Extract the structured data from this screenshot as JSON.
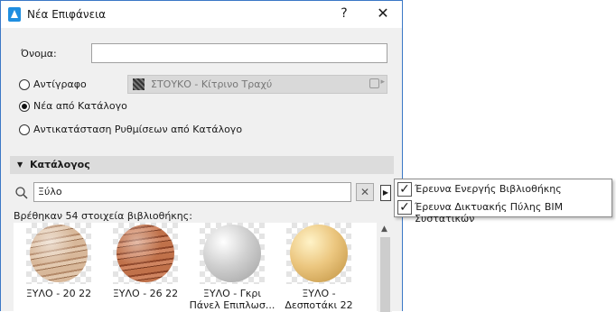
{
  "window": {
    "title": "Νέα Επιφάνεια",
    "help": "?",
    "close": "✕"
  },
  "form": {
    "name_label": "Όνομα:",
    "name_value": "",
    "options": [
      {
        "label": "Αντίγραφο",
        "selected": false
      },
      {
        "label": "Νέα από Κατάλογο",
        "selected": true
      },
      {
        "label": "Αντικατάσταση Ρυθμίσεων από Κατάλογο",
        "selected": false
      }
    ],
    "copy_source": "ΣΤΟΥΚΟ - Κίτρινο Τραχύ"
  },
  "catalog": {
    "section_label": "Κατάλογος",
    "search_value": "Ξύλο",
    "clear_label": "✕",
    "more_label": "▶",
    "found_text": "Βρέθηκαν 54 στοιχεία βιβλιοθήκης:",
    "items": [
      {
        "label": "ΞΥΛΟ - 20 22"
      },
      {
        "label": "ΞΥΛΟ - 26 22"
      },
      {
        "label": "ΞΥΛΟ - Γκρι Πάνελ Επιπλωσ..."
      },
      {
        "label": "ΞΥΛΟ - Δεσποτάκι 22"
      }
    ]
  },
  "search_menu": {
    "items": [
      {
        "label": "Έρευνα Ενεργής Βιβλιοθήκης",
        "checked": true
      },
      {
        "label": "Έρευνα Δικτυακής Πύλης BIM Συστατικών",
        "checked": true
      }
    ]
  },
  "colors": {
    "window_border": "#3b78c6",
    "app_icon": "#1f8ee0",
    "dialog_bg": "#f0f0f0",
    "section_bar": "#dcdcdc"
  }
}
